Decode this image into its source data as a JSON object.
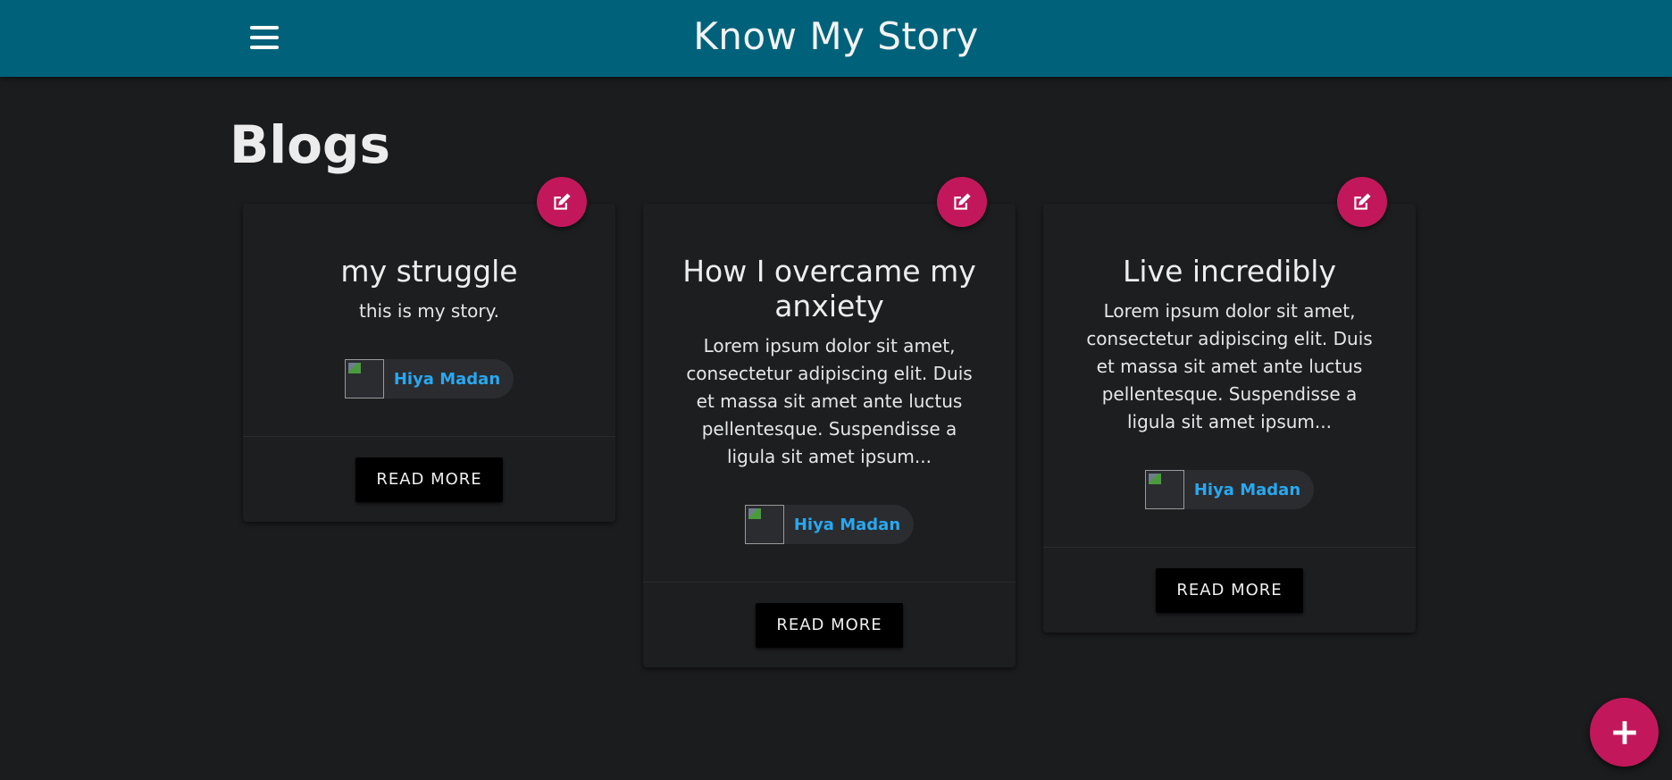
{
  "app": {
    "title": "Know My Story"
  },
  "page": {
    "heading": "Blogs"
  },
  "cards": [
    {
      "title": "my struggle",
      "excerpt": "this is my story.",
      "author": "Hiya Madan",
      "action": "READ MORE"
    },
    {
      "title": "How I overcame my anxiety",
      "excerpt": "Lorem ipsum dolor sit amet, consectetur adipiscing elit. Duis et massa sit amet ante luctus pellentesque. Suspendisse a ligula sit amet ipsum...",
      "author": "Hiya Madan",
      "action": "READ MORE"
    },
    {
      "title": "Live incredibly",
      "excerpt": "Lorem ipsum dolor sit amet, consectetur adipiscing elit. Duis et massa sit amet ante luctus pellentesque. Suspendisse a ligula sit amet ipsum...",
      "author": "Hiya Madan",
      "action": "READ MORE"
    }
  ],
  "icons": {
    "menu": "menu-icon",
    "edit": "edit-icon",
    "add": "plus-icon"
  },
  "colors": {
    "header": "#00627a",
    "background": "#1b1c1e",
    "card": "#1d1e20",
    "accent": "#c2185b",
    "author_link": "#29a8f0"
  }
}
